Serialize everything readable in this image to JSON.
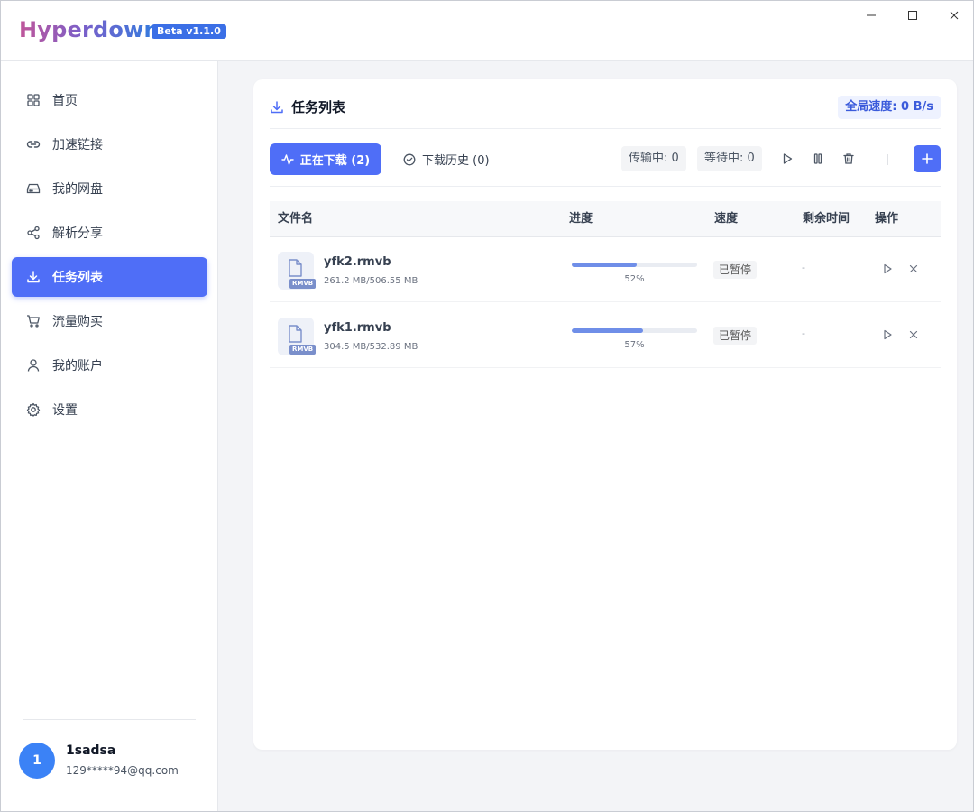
{
  "app": {
    "brand": "Hyperdown",
    "version_badge": "Beta v1.1.0"
  },
  "window_controls": [
    "minimize-icon",
    "maximize-icon",
    "close-icon"
  ],
  "sidebar": {
    "items": [
      {
        "label": "首页",
        "icon": "grid-icon",
        "active": false
      },
      {
        "label": "加速链接",
        "icon": "link-icon",
        "active": false
      },
      {
        "label": "我的网盘",
        "icon": "drive-icon",
        "active": false
      },
      {
        "label": "解析分享",
        "icon": "share-icon",
        "active": false
      },
      {
        "label": "任务列表",
        "icon": "download-icon",
        "active": true
      },
      {
        "label": "流量购买",
        "icon": "cart-icon",
        "active": false
      },
      {
        "label": "我的账户",
        "icon": "user-icon",
        "active": false
      },
      {
        "label": "设置",
        "icon": "gear-icon",
        "active": false
      }
    ],
    "user": {
      "avatar_text": "1",
      "name": "1sadsa",
      "email": "129*****94@qq.com"
    }
  },
  "main": {
    "title": "任务列表",
    "global_speed": "全局速度: 0 B/s",
    "tabs": {
      "downloading": "正在下载 (2)",
      "history": "下载历史 (0)"
    },
    "stats": {
      "transferring": "传输中: 0",
      "waiting": "等待中: 0"
    },
    "toolbar_icons": [
      "play-icon",
      "pause-icon",
      "trash-icon",
      "plus-icon"
    ],
    "table": {
      "columns": [
        "文件名",
        "进度",
        "速度",
        "剩余时间",
        "操作"
      ],
      "rows": [
        {
          "name": "yfk2.rmvb",
          "ext": "RMVB",
          "size": "261.2 MB/506.55 MB",
          "progress": 0.52,
          "progress_text": "52%",
          "status": "已暂停",
          "remaining": "-"
        },
        {
          "name": "yfk1.rmvb",
          "ext": "RMVB",
          "size": "304.5 MB/532.89 MB",
          "progress": 0.57,
          "progress_text": "57%",
          "status": "已暂停",
          "remaining": "-"
        }
      ]
    }
  },
  "colors": {
    "accent": "#4f6ef7",
    "progress": "#6f8ee8"
  }
}
